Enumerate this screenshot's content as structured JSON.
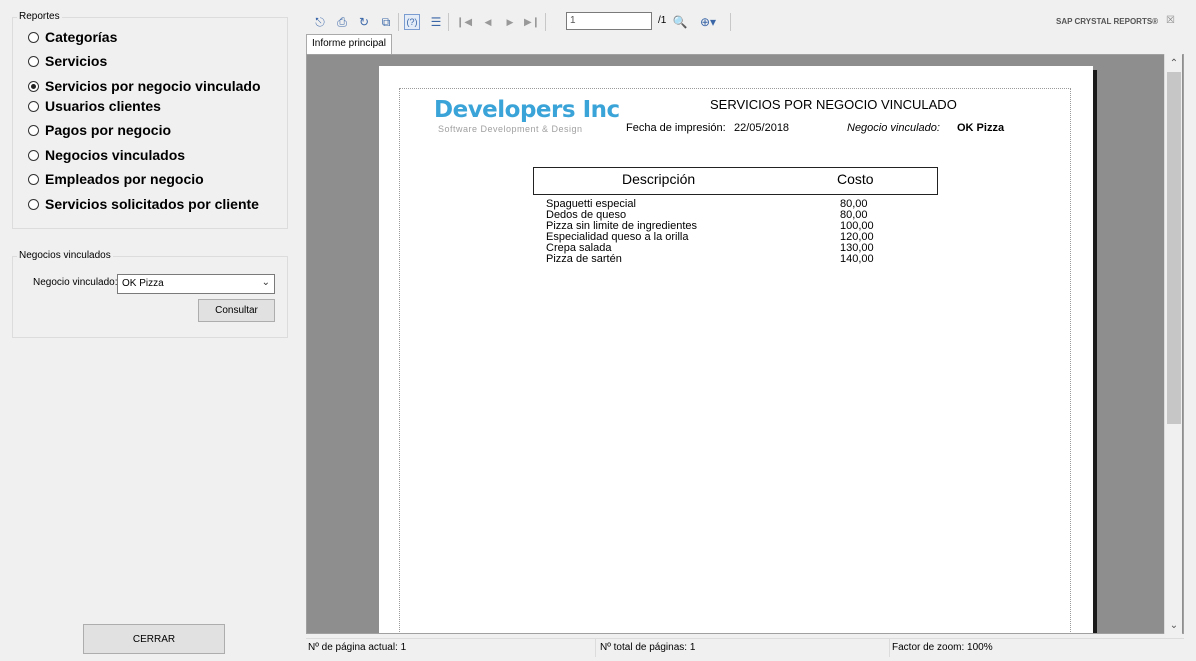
{
  "reportes": {
    "title": "Reportes",
    "options": [
      {
        "label": "Categorías",
        "checked": false
      },
      {
        "label": "Servicios",
        "checked": false
      },
      {
        "label": "Servicios por negocio vinculado",
        "checked": true
      },
      {
        "label": "Usuarios clientes",
        "checked": false
      },
      {
        "label": "Pagos por negocio",
        "checked": false
      },
      {
        "label": "Negocios vinculados",
        "checked": false
      },
      {
        "label": "Empleados por negocio",
        "checked": false
      },
      {
        "label": "Servicios solicitados por cliente",
        "checked": false
      }
    ]
  },
  "negocios": {
    "title": "Negocios vinculados",
    "field_label": "Negocio vinculado:",
    "selected": "OK Pizza",
    "consult_label": "Consultar"
  },
  "close_label": "CERRAR",
  "viewer": {
    "page_input": "1",
    "page_total": "/1",
    "brand": "SAP CRYSTAL REPORTS®",
    "tab_label": "Informe principal",
    "icons": [
      "export-icon",
      "print-icon",
      "refresh-icon",
      "copy-icon",
      "help-icon",
      "group-tree-icon",
      "first-page-icon",
      "prev-page-icon",
      "next-page-icon",
      "last-page-icon",
      "find-icon",
      "zoom-icon"
    ]
  },
  "report": {
    "logo": "Developers Inc",
    "logo_sub": "Software Development & Design",
    "title": "SERVICIOS POR NEGOCIO VINCULADO",
    "print_label": "Fecha de impresión:",
    "print_date": "22/05/2018",
    "negocio_label": "Negocio vinculado:",
    "negocio_value": "OK Pizza",
    "col_desc": "Descripción",
    "col_cost": "Costo",
    "rows": [
      {
        "desc": "Spaguetti especial",
        "cost": "80,00"
      },
      {
        "desc": "Dedos de queso",
        "cost": "80,00"
      },
      {
        "desc": "Pizza sin limite de ingredientes",
        "cost": "100,00"
      },
      {
        "desc": "Especialidad queso a la orilla",
        "cost": "120,00"
      },
      {
        "desc": "Crepa salada",
        "cost": "130,00"
      },
      {
        "desc": "Pizza de sartén",
        "cost": "140,00"
      }
    ]
  },
  "status": {
    "current_page": "Nº de página actual: 1",
    "total_pages": "Nº total de páginas: 1",
    "zoom": "Factor de zoom: 100%"
  }
}
